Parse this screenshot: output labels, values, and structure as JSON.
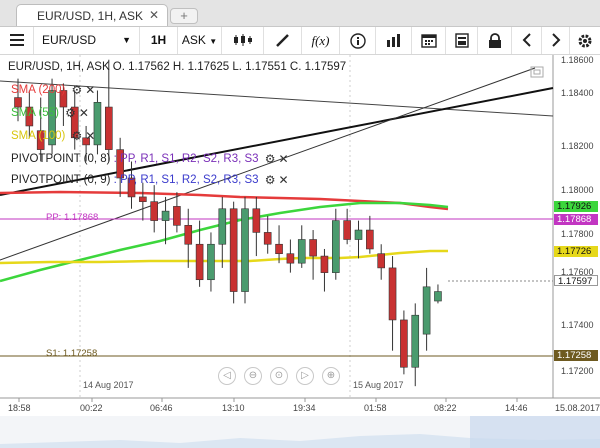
{
  "tab": {
    "label": "EUR/USD, 1H, ASK",
    "close": "✕",
    "new_tab": "+"
  },
  "toolbar": {
    "symbol": "EUR/USD",
    "timeframe": "1H",
    "side": "ASK",
    "fx": "f(x)"
  },
  "legend": {
    "header": "EUR/USD, 1H, ASK   O. 1.17562 H. 1.17625 L. 1.17551 C. 1.17597",
    "sma200": "SMA (200)",
    "sma55": "SMA (55)",
    "sma100": "SMA (100)",
    "pivot1_name": "PIVOTPOINT (0, 8)",
    "pivot1_rest": " : PP, R1, S1, R2, S2, R3, S3",
    "pivot2_name": "PIVOTPOINT (0, 9)",
    "pivot2_rest": " : PP, R1, S1, R2, S2, R3, S3"
  },
  "chart_labels": {
    "pp": "PP: 1.17868",
    "s1": "S1: 1.17258",
    "date1": "14 Aug 2017",
    "date2": "15 Aug 2017"
  },
  "price_axis": [
    "1.18600",
    "1.18400",
    "1.18200",
    "1.18000",
    "1.17800",
    "1.17600",
    "1.17400",
    "1.17200"
  ],
  "price_boxes": {
    "sma55": "1.17926",
    "pp": "1.17868",
    "sma100": "1.17726",
    "last": "1.17597",
    "s1": "1.17258"
  },
  "time_axis": [
    "18:58",
    "00:22",
    "06:46",
    "13:10",
    "19:34",
    "01:58",
    "08:22",
    "14:46",
    "15.08.2017"
  ],
  "colors": {
    "sma200": "#e53b3b",
    "sma55": "#3cd63c",
    "sma100": "#e6d81a",
    "pp": "#c236c2",
    "s1": "#6e5a20",
    "bull": "#4a9b6e",
    "bear": "#c83232"
  },
  "chart_data": {
    "type": "candlestick",
    "price_range": [
      1.1715,
      1.186
    ],
    "candles": [
      {
        "o": 1.1842,
        "h": 1.185,
        "l": 1.1832,
        "c": 1.1838
      },
      {
        "o": 1.1838,
        "h": 1.1845,
        "l": 1.1825,
        "c": 1.183
      },
      {
        "o": 1.1828,
        "h": 1.1842,
        "l": 1.1815,
        "c": 1.182
      },
      {
        "o": 1.1822,
        "h": 1.185,
        "l": 1.1818,
        "c": 1.1845
      },
      {
        "o": 1.1845,
        "h": 1.1848,
        "l": 1.183,
        "c": 1.1838
      },
      {
        "o": 1.1838,
        "h": 1.1845,
        "l": 1.182,
        "c": 1.1825
      },
      {
        "o": 1.1825,
        "h": 1.183,
        "l": 1.1815,
        "c": 1.1822
      },
      {
        "o": 1.1822,
        "h": 1.1845,
        "l": 1.1818,
        "c": 1.184
      },
      {
        "o": 1.1838,
        "h": 1.1858,
        "l": 1.1815,
        "c": 1.182
      },
      {
        "o": 1.182,
        "h": 1.1825,
        "l": 1.18,
        "c": 1.1808
      },
      {
        "o": 1.1808,
        "h": 1.1815,
        "l": 1.1795,
        "c": 1.18
      },
      {
        "o": 1.18,
        "h": 1.1806,
        "l": 1.179,
        "c": 1.1798
      },
      {
        "o": 1.1798,
        "h": 1.1805,
        "l": 1.1785,
        "c": 1.179
      },
      {
        "o": 1.179,
        "h": 1.18,
        "l": 1.178,
        "c": 1.1794
      },
      {
        "o": 1.1796,
        "h": 1.1802,
        "l": 1.1785,
        "c": 1.1788
      },
      {
        "o": 1.1788,
        "h": 1.1795,
        "l": 1.177,
        "c": 1.178
      },
      {
        "o": 1.178,
        "h": 1.179,
        "l": 1.1762,
        "c": 1.1765
      },
      {
        "o": 1.1765,
        "h": 1.1785,
        "l": 1.176,
        "c": 1.178
      },
      {
        "o": 1.178,
        "h": 1.18,
        "l": 1.177,
        "c": 1.1795
      },
      {
        "o": 1.1795,
        "h": 1.1798,
        "l": 1.1755,
        "c": 1.176
      },
      {
        "o": 1.176,
        "h": 1.18,
        "l": 1.1755,
        "c": 1.1795
      },
      {
        "o": 1.1795,
        "h": 1.18,
        "l": 1.1775,
        "c": 1.1785
      },
      {
        "o": 1.1785,
        "h": 1.1792,
        "l": 1.1776,
        "c": 1.178
      },
      {
        "o": 1.178,
        "h": 1.1788,
        "l": 1.1772,
        "c": 1.1776
      },
      {
        "o": 1.1776,
        "h": 1.1782,
        "l": 1.1768,
        "c": 1.1772
      },
      {
        "o": 1.1772,
        "h": 1.1788,
        "l": 1.177,
        "c": 1.1782
      },
      {
        "o": 1.1782,
        "h": 1.1786,
        "l": 1.1765,
        "c": 1.1775
      },
      {
        "o": 1.1775,
        "h": 1.1778,
        "l": 1.176,
        "c": 1.1768
      },
      {
        "o": 1.1768,
        "h": 1.1795,
        "l": 1.1765,
        "c": 1.179
      },
      {
        "o": 1.179,
        "h": 1.1795,
        "l": 1.178,
        "c": 1.1782
      },
      {
        "o": 1.1782,
        "h": 1.179,
        "l": 1.1774,
        "c": 1.1786
      },
      {
        "o": 1.1786,
        "h": 1.1792,
        "l": 1.1776,
        "c": 1.1778
      },
      {
        "o": 1.1776,
        "h": 1.178,
        "l": 1.1765,
        "c": 1.177
      },
      {
        "o": 1.177,
        "h": 1.1775,
        "l": 1.1735,
        "c": 1.1748
      },
      {
        "o": 1.1748,
        "h": 1.1752,
        "l": 1.1725,
        "c": 1.1728
      },
      {
        "o": 1.1728,
        "h": 1.1755,
        "l": 1.172,
        "c": 1.175
      },
      {
        "o": 1.1742,
        "h": 1.177,
        "l": 1.1735,
        "c": 1.1762
      },
      {
        "o": 1.1756,
        "h": 1.1763,
        "l": 1.1755,
        "c": 1.176
      }
    ]
  }
}
